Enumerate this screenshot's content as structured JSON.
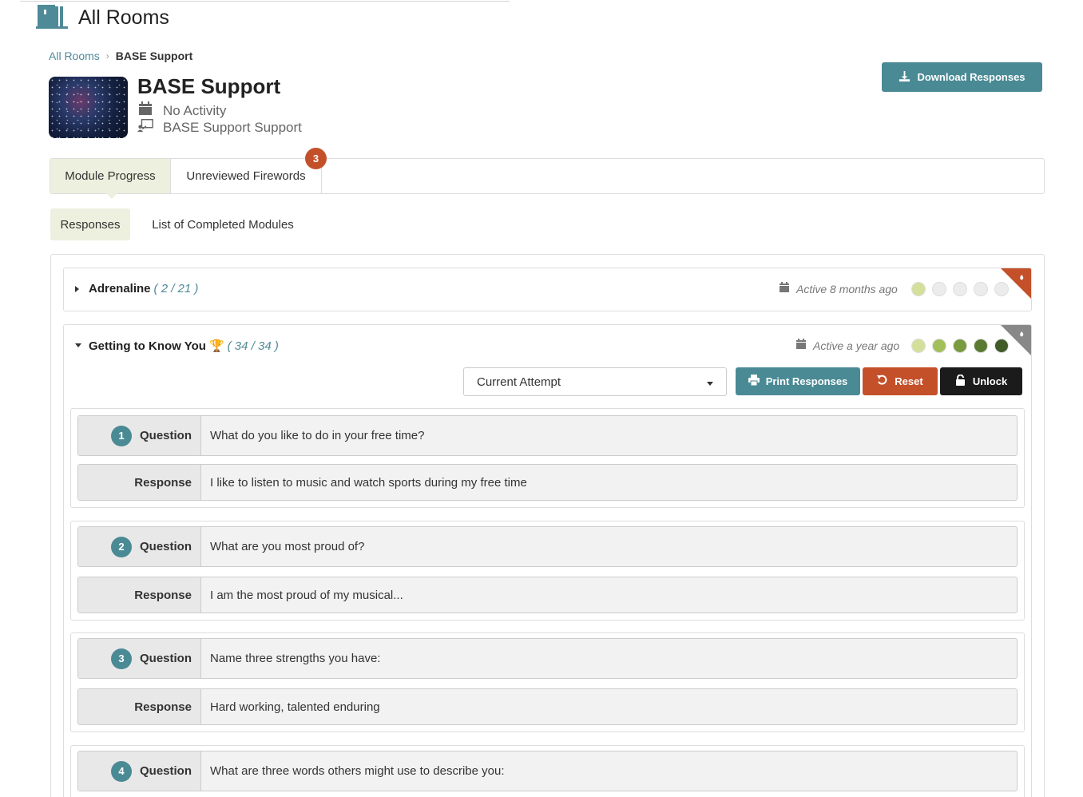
{
  "header": {
    "title": "All Rooms"
  },
  "breadcrumb": {
    "parent": "All Rooms",
    "current": "BASE Support"
  },
  "room": {
    "name": "BASE Support",
    "activity": "No Activity",
    "support": "BASE Support Support",
    "download_label": "Download Responses"
  },
  "tabs": {
    "module_progress": "Module Progress",
    "unreviewed_firewords": "Unreviewed Firewords",
    "badge_count": "3"
  },
  "subtabs": {
    "responses": "Responses",
    "completed": "List of Completed Modules"
  },
  "modules": [
    {
      "title": "Adrenaline",
      "count": "( 2 / 21 )",
      "active": "Active 8 months ago",
      "dots": [
        "#d4e09a",
        "#ececec",
        "#ececec",
        "#ececec",
        "#ececec"
      ],
      "corner_color": "#c4502a"
    },
    {
      "title": "Getting to Know You",
      "count": "( 34 / 34 )",
      "active": "Active a year ago",
      "dots": [
        "#d4e09a",
        "#a3bf5a",
        "#7a9a40",
        "#5a7a32",
        "#405a28"
      ],
      "corner_color": "#888888",
      "attempt_select": "Current Attempt",
      "print_label": "Print Responses",
      "reset_label": "Reset",
      "unlock_label": "Unlock"
    }
  ],
  "labels": {
    "question": "Question",
    "response": "Response"
  },
  "qa": [
    {
      "num": "1",
      "question": "What do you like to do in your free time?",
      "response": "I like to listen to music and watch sports during my free time"
    },
    {
      "num": "2",
      "question": "What are you most proud of?",
      "response": "I am the most proud of my musical..."
    },
    {
      "num": "3",
      "question": "Name three strengths you have:",
      "response": "Hard working, talented enduring"
    },
    {
      "num": "4",
      "question": "What are three words others might use to describe you:",
      "response": ""
    }
  ],
  "colors": {
    "accent": "#4a8a95",
    "danger": "#c4502a",
    "dark": "#1b1b1b",
    "tab_active": "#eef0df"
  }
}
